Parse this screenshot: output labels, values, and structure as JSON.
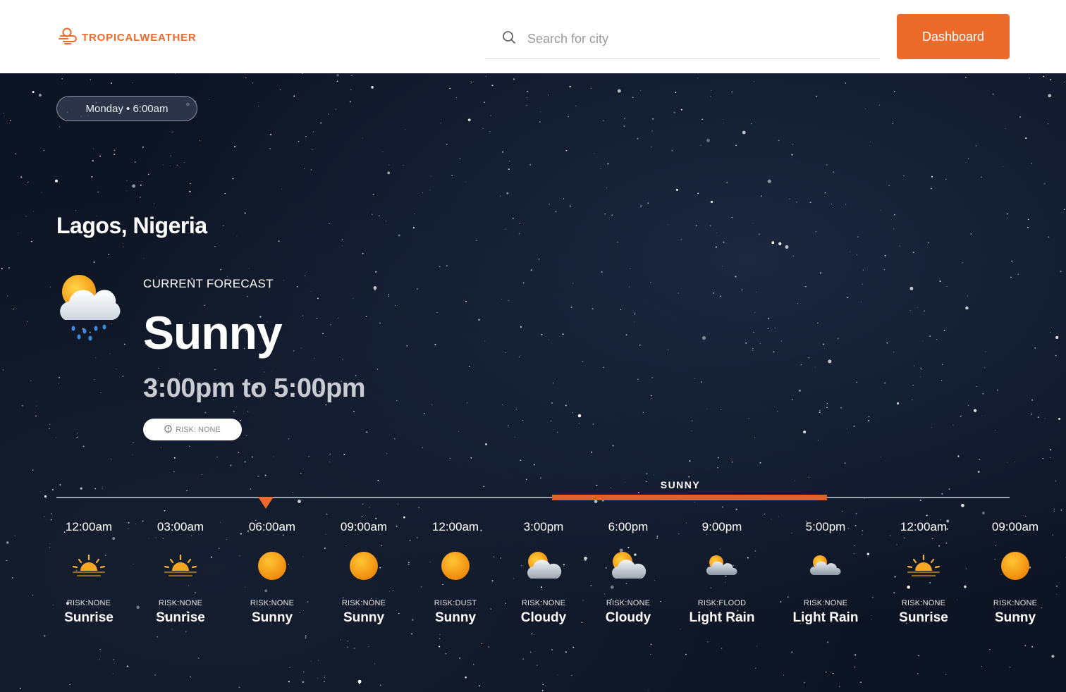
{
  "header": {
    "logo_text": "TROPICALWEATHER",
    "search_placeholder": "Search for city",
    "dashboard_label": "Dashboard"
  },
  "hero": {
    "date_time": "Monday • 6:00am",
    "city": "Lagos, Nigeria",
    "current": {
      "label": "CURRENT FORECAST",
      "condition": "Sunny",
      "range": "3:00pm to 5:00pm",
      "risk": "RISK: NONE",
      "icon": "sun-cloud-rain-icon"
    }
  },
  "timeline": {
    "highlight_label": "SUNNY",
    "slots": [
      {
        "time": "12:00am",
        "icon": "sunrise-icon",
        "risk": "RISK:NONE",
        "condition": "Sunrise"
      },
      {
        "time": "03:00am",
        "icon": "sunrise-icon",
        "risk": "RISK:NONE",
        "condition": "Sunrise"
      },
      {
        "time": "06:00am",
        "icon": "sun-icon",
        "risk": "RISK:NONE",
        "condition": "Sunny"
      },
      {
        "time": "09:00am",
        "icon": "sun-icon",
        "risk": "RISK:NONE",
        "condition": "Sunny"
      },
      {
        "time": "12:00am",
        "icon": "sun-icon",
        "risk": "RISK:DUST",
        "condition": "Sunny"
      },
      {
        "time": "3:00pm",
        "icon": "sun-cloud-icon",
        "risk": "RISK:NONE",
        "condition": "Cloudy"
      },
      {
        "time": "6:00pm",
        "icon": "sun-cloud-icon",
        "risk": "RISK:NONE",
        "condition": "Cloudy"
      },
      {
        "time": "9:00pm",
        "icon": "small-sun-cloud-icon",
        "risk": "RISK:FLOOD",
        "condition": "Light Rain"
      },
      {
        "time": "5:00pm",
        "icon": "small-sun-cloud-icon",
        "risk": "RISK:NONE",
        "condition": "Light Rain"
      },
      {
        "time": "12:00am",
        "icon": "sunrise-icon",
        "risk": "RISK:NONE",
        "condition": "Sunrise"
      },
      {
        "time": "09:00am",
        "icon": "sun-icon",
        "risk": "RISK:NONE",
        "condition": "Sunny"
      }
    ]
  },
  "colors": {
    "accent": "#ec6b2b",
    "highlight": "#e0622a",
    "sun": "#f59a1b"
  }
}
